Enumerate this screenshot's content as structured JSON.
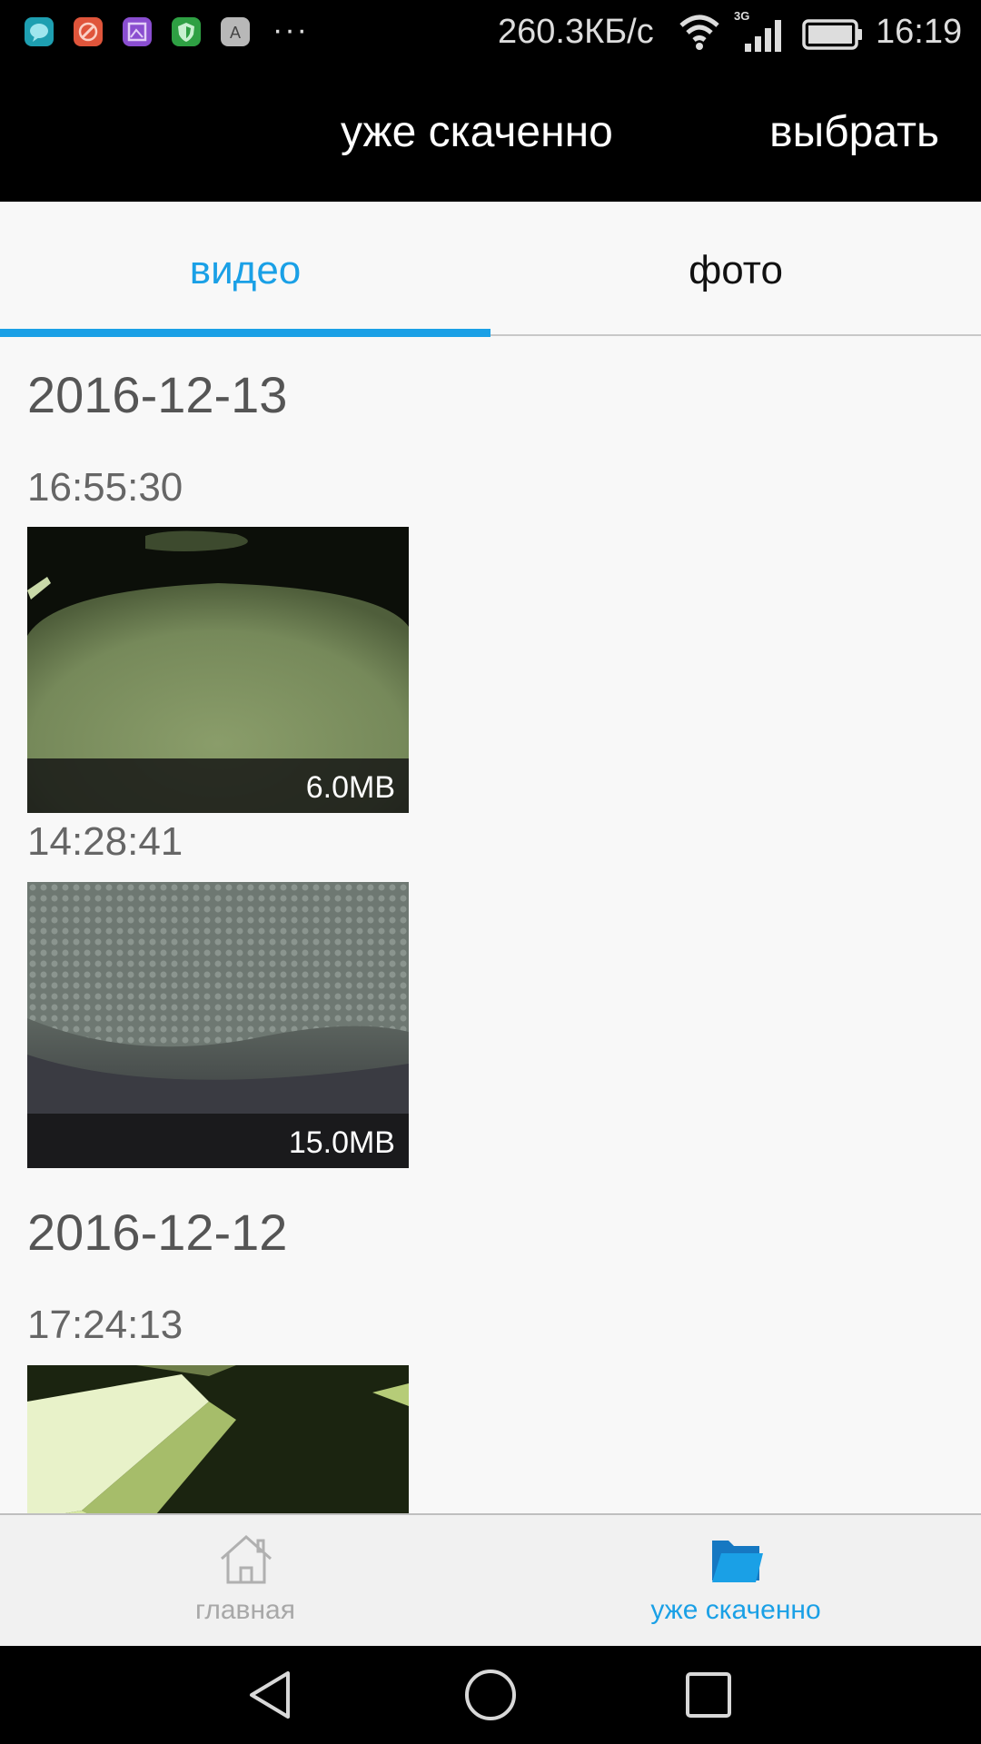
{
  "status_bar": {
    "dots": "···",
    "speed": "260.3КБ/с",
    "network_type": "3G",
    "time": "16:19",
    "app_icons": [
      {
        "icon": "chat-app-icon",
        "color": "#1e9fb1"
      },
      {
        "icon": "tools-app-icon",
        "color": "#e0553b"
      },
      {
        "icon": "gallery-app-icon",
        "color": "#8a4ed0"
      },
      {
        "icon": "shield-app-icon",
        "color": "#2ea043"
      },
      {
        "icon": "keyboard-app-icon",
        "color": "#b8b8b8",
        "letter": "A"
      }
    ]
  },
  "app_bar": {
    "title": "уже скаченно",
    "select_label": "выбрать"
  },
  "tabs": [
    {
      "label": "видео",
      "active": true
    },
    {
      "label": "фото",
      "active": false
    }
  ],
  "groups": [
    {
      "date": "2016-12-13",
      "items": [
        {
          "time": "16:55:30",
          "size": "6.0MB"
        },
        {
          "time": "14:28:41",
          "size": "15.0MB"
        }
      ]
    },
    {
      "date": "2016-12-12",
      "items": [
        {
          "time": "17:24:13",
          "size": ""
        }
      ]
    }
  ],
  "bottom_nav": {
    "home_label": "главная",
    "downloaded_label": "уже скаченно"
  },
  "colors": {
    "accent": "#1aa0e6",
    "bar_bg": "#000000"
  }
}
